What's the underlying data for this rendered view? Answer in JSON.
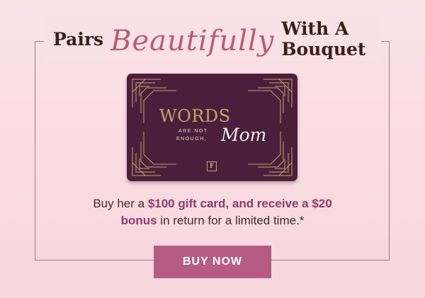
{
  "heading": {
    "word1": "Pairs",
    "script": "Beautifully",
    "word2": "With A Bouquet"
  },
  "card": {
    "title": "WORDS",
    "line1": "ARE NOT",
    "line2": "ENOUGH,",
    "script": "Mom",
    "logo": "F",
    "colors": {
      "background": "#4b1f3b",
      "gold": "#c5a36c"
    }
  },
  "offer": {
    "text_start": "Buy her a ",
    "emphasis1": "$100 gift card, and receive a $20",
    "emphasis2": "bonus",
    "text_end": " in return for a limited time.*"
  },
  "cta": {
    "label": "BUY NOW",
    "color": "#b65c84"
  }
}
